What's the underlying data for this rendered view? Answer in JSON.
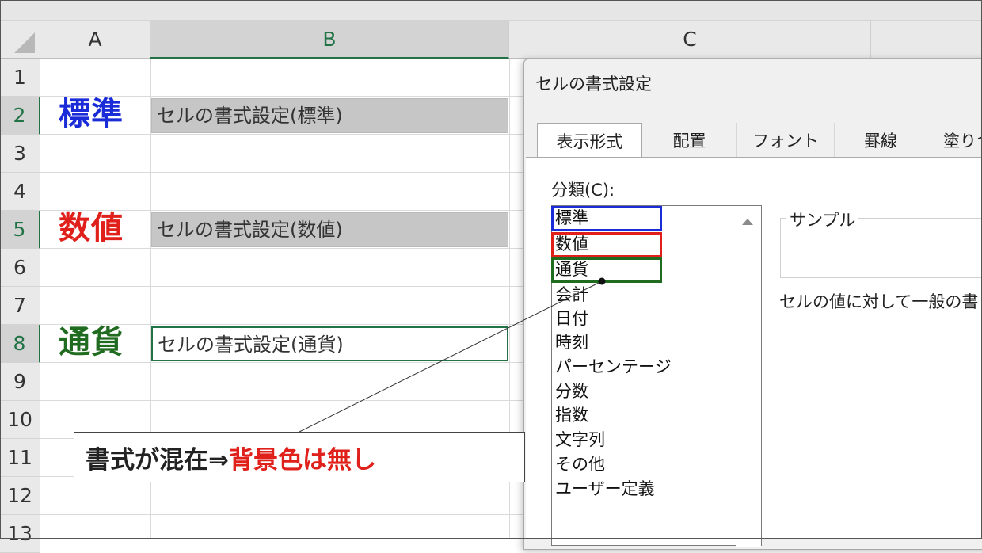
{
  "sheet": {
    "columns": [
      "A",
      "B",
      "C"
    ],
    "rows": [
      "1",
      "2",
      "3",
      "4",
      "5",
      "6",
      "7",
      "8",
      "9",
      "10",
      "11",
      "12",
      "13"
    ],
    "labels": [
      {
        "text": "標準",
        "color": "#1a2bd8"
      },
      {
        "text": "数値",
        "color": "#e0201b"
      },
      {
        "text": "通貨",
        "color": "#1f6b1f"
      }
    ],
    "cells": [
      "セルの書式設定(標準)",
      "セルの書式設定(数値)",
      "セルの書式設定(通貨)"
    ]
  },
  "dialog": {
    "title": "セルの書式設定",
    "tabs": [
      "表示形式",
      "配置",
      "フォント",
      "罫線",
      "塗りつ"
    ],
    "category_label": "分類(C):",
    "categories": [
      "標準",
      "数値",
      "通貨",
      "会計",
      "日付",
      "時刻",
      "パーセンテージ",
      "分数",
      "指数",
      "文字列",
      "その他",
      "ユーザー定義"
    ],
    "sample_label": "サンプル",
    "description": "セルの値に対して一般の書"
  },
  "callout": {
    "black_text": "書式が混在⇒",
    "red_text": "背景色は無し",
    "red_color": "#e0201b"
  }
}
